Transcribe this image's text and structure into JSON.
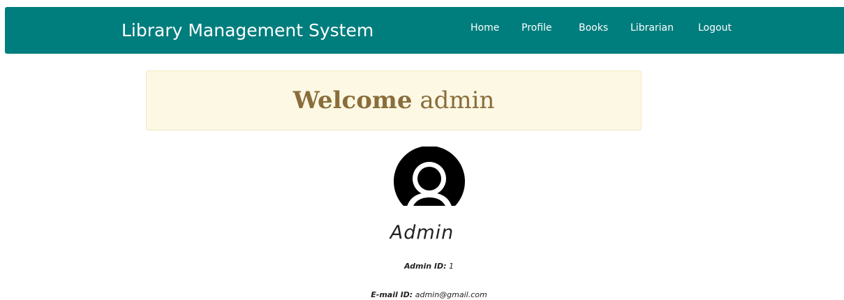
{
  "navbar": {
    "brand": "Library Management System",
    "links": [
      "Home",
      "Profile",
      "Books",
      "Librarian",
      "Logout"
    ],
    "background": "#007d7d"
  },
  "welcome": {
    "greeting": "Welcome",
    "username": "admin"
  },
  "profile": {
    "avatar_icon": "user-avatar-icon",
    "name": "Admin",
    "admin_id_label": "Admin ID:",
    "admin_id_value": "1",
    "email_label": "E-mail ID:",
    "email_value": "admin@gmail.com"
  }
}
